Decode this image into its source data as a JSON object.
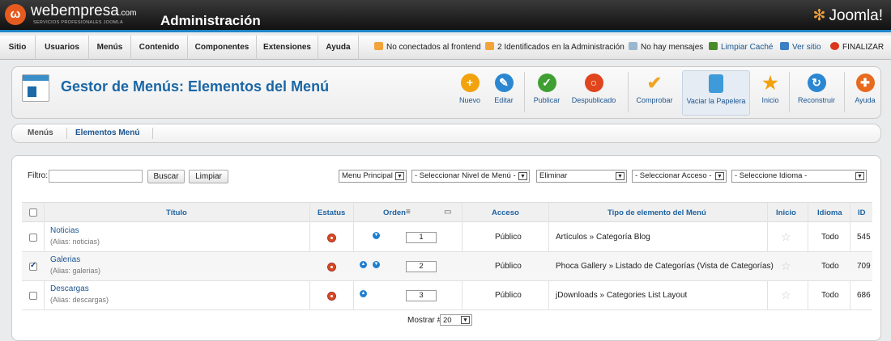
{
  "brand": {
    "logo_text": "ω",
    "name": "webempresa",
    "tld": ".com",
    "tagline": "SERVICIOS PROFESIONALES JOOMLA",
    "admin": "Administración",
    "joomla": "Joomla!"
  },
  "menubar": {
    "items": [
      "Sitio",
      "Usuarios",
      "Menús",
      "Contenido",
      "Componentes",
      "Extensiones",
      "Ayuda"
    ],
    "status": [
      {
        "label": "No conectados al frontend",
        "icon": "users-icon",
        "color": "#f2a33a"
      },
      {
        "label": "2 Identificados en la Administración",
        "icon": "users-icon",
        "color": "#f2a33a"
      },
      {
        "label": "No hay mensajes",
        "icon": "mail-icon",
        "color": "#9bb6cf"
      },
      {
        "label": "Limpiar Caché",
        "icon": "broom-icon",
        "color": "#4a8a2a"
      },
      {
        "label": "Ver sitio",
        "icon": "monitor-icon",
        "color": "#3b7fc4"
      },
      {
        "label": "FINALIZAR",
        "icon": "power-icon",
        "color": "#d9371e"
      }
    ]
  },
  "toolbar": {
    "title": "Gestor de Menús: Elementos del Menú",
    "buttons": [
      {
        "label": "Nuevo",
        "icon": "new-icon",
        "glyph": "+",
        "color": "#f2a20c"
      },
      {
        "label": "Editar",
        "icon": "edit-icon",
        "glyph": "✎",
        "color": "#2b87d1"
      },
      {
        "label": "Publicar",
        "icon": "publish-icon",
        "glyph": "✓",
        "color": "#3f9f32"
      },
      {
        "label": "Despublicado",
        "icon": "unpublish-icon",
        "glyph": "○",
        "color": "#e0451d"
      },
      {
        "label": "Comprobar",
        "icon": "checkin-icon",
        "glyph": "✔",
        "color": "#f0a420"
      },
      {
        "label": "Vaciar la Papelera",
        "icon": "trash-icon",
        "glyph": "🗑",
        "color": "#3e9ad8"
      },
      {
        "label": "Inicio",
        "icon": "home-star-icon",
        "glyph": "★",
        "color": "#f2a20c"
      },
      {
        "label": "Reconstruir",
        "icon": "refresh-icon",
        "glyph": "↻",
        "color": "#2b87d1"
      },
      {
        "label": "Ayuda",
        "icon": "help-icon",
        "glyph": "✚",
        "color": "#e86a1e"
      }
    ]
  },
  "subtabs": [
    "Menús",
    "Elementos Menú"
  ],
  "filter": {
    "label": "Filtro:",
    "value": "",
    "search": "Buscar",
    "clear": "Limpiar",
    "selects": [
      "Menu Principal",
      "- Seleccionar Nivel de Menú -",
      "Eliminar",
      "- Seleccionar Acceso -",
      "- Seleccione Idioma -"
    ]
  },
  "table": {
    "headers": [
      "Título",
      "Estatus",
      "Orden",
      "Acceso",
      "Tipo de elemento del Menú",
      "Inicio",
      "Idioma",
      "ID"
    ],
    "rows": [
      {
        "title": "Noticias",
        "alias": "(Alias: noticias)",
        "checked": false,
        "up": false,
        "down": true,
        "order": "1",
        "access": "Público",
        "type": "Artículos » Categoría Blog",
        "lang": "Todo",
        "id": "545"
      },
      {
        "title": "Galerias",
        "alias": "(Alias: galerias)",
        "checked": true,
        "up": true,
        "down": true,
        "order": "2",
        "access": "Público",
        "type": "Phoca Gallery » Listado de Categorías (Vista de Categorías)",
        "lang": "Todo",
        "id": "709"
      },
      {
        "title": "Descargas",
        "alias": "(Alias: descargas)",
        "checked": false,
        "up": true,
        "down": false,
        "order": "3",
        "access": "Público",
        "type": "jDownloads » Categories List Layout",
        "lang": "Todo",
        "id": "686"
      }
    ]
  },
  "pagination": {
    "label": "Mostrar #",
    "value": "20"
  }
}
